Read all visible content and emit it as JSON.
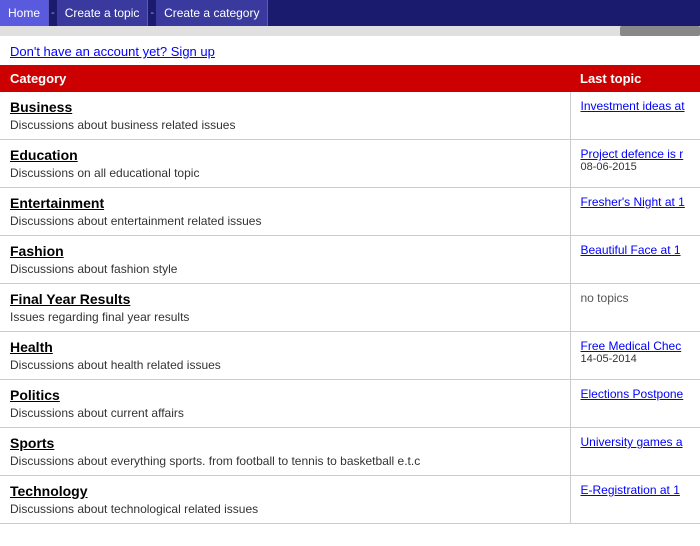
{
  "navbar": {
    "items": [
      {
        "label": "Home",
        "name": "nav-home"
      },
      {
        "label": "Create a topic",
        "name": "nav-create-topic"
      },
      {
        "label": "Create a category",
        "name": "nav-create-category"
      }
    ]
  },
  "signup": {
    "text": "Don't have an account yet? Sign up"
  },
  "table": {
    "headers": [
      "Category",
      "Last topic"
    ],
    "rows": [
      {
        "name": "Business",
        "desc": "Discussions about business related issues",
        "last_topic_link": "Investment ideas at",
        "last_topic_date": "",
        "no_topics": false
      },
      {
        "name": "Education",
        "desc": "Discussions on all educational topic",
        "last_topic_link": "Project defence is r",
        "last_topic_date": "08-06-2015",
        "no_topics": false
      },
      {
        "name": "Entertainment",
        "desc": "Discussions about entertainment related issues",
        "last_topic_link": "Fresher's Night at 1",
        "last_topic_date": "",
        "no_topics": false
      },
      {
        "name": "Fashion",
        "desc": "Discussions about fashion style",
        "last_topic_link": "Beautiful Face at 1",
        "last_topic_date": "",
        "no_topics": false
      },
      {
        "name": "Final Year Results",
        "desc": "Issues regarding final year results",
        "last_topic_link": "",
        "last_topic_date": "",
        "no_topics": true,
        "no_topics_text": "no topics"
      },
      {
        "name": "Health",
        "desc": "Discussions about health related issues",
        "last_topic_link": "Free Medical Chec",
        "last_topic_date": "14-05-2014",
        "no_topics": false
      },
      {
        "name": "Politics",
        "desc": "Discussions about current affairs",
        "last_topic_link": "Elections Postpone",
        "last_topic_date": "",
        "no_topics": false
      },
      {
        "name": "Sports",
        "desc": "Discussions about everything sports. from football to tennis to basketball e.t.c",
        "last_topic_link": "University games a",
        "last_topic_date": "",
        "no_topics": false
      },
      {
        "name": "Technology",
        "desc": "Discussions about technological related issues",
        "last_topic_link": "E-Registration at 1",
        "last_topic_date": "",
        "no_topics": false
      }
    ]
  }
}
